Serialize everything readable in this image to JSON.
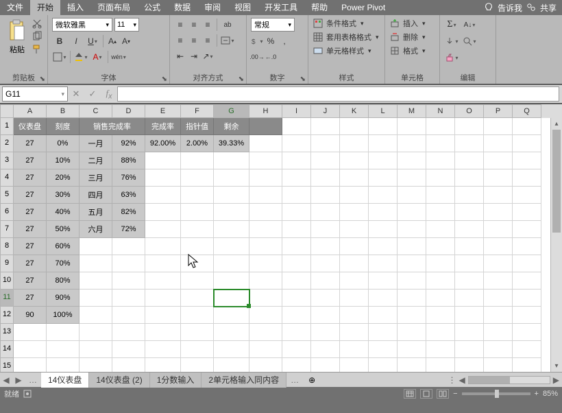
{
  "tabs": {
    "file": "文件",
    "home": "开始",
    "insert": "插入",
    "layout": "页面布局",
    "formula": "公式",
    "data": "数据",
    "review": "审阅",
    "view": "视图",
    "dev": "开发工具",
    "help": "帮助",
    "pivot": "Power Pivot",
    "tell": "告诉我",
    "share": "共享"
  },
  "ribbon": {
    "paste": "粘贴",
    "clipboard": "剪贴板",
    "font_name": "微软雅黑",
    "font_size": "11",
    "font_group": "字体",
    "align_group": "对齐方式",
    "wrap_char": "ab",
    "num_format": "常规",
    "num_group": "数字",
    "cond": "条件格式",
    "table_fmt": "套用表格格式",
    "cell_fmt": "单元格样式",
    "style_group": "样式",
    "insert_btn": "插入",
    "delete_btn": "删除",
    "format_btn": "格式",
    "cell_group": "单元格",
    "edit_group": "编辑"
  },
  "namebox": "G11",
  "columns": [
    "A",
    "B",
    "C",
    "D",
    "E",
    "F",
    "G",
    "H",
    "I",
    "J",
    "K",
    "L",
    "M",
    "N",
    "O",
    "P",
    "Q"
  ],
  "headers": {
    "a": "仪表盘",
    "b": "刻度",
    "cd": "销售完成率",
    "e": "完成率",
    "f": "指针值",
    "g": "剩余"
  },
  "rows": [
    {
      "a": "27",
      "b": "0%",
      "c": "一月",
      "d": "92%",
      "e": "92.00%",
      "f": "2.00%",
      "g": "39.33%"
    },
    {
      "a": "27",
      "b": "10%",
      "c": "二月",
      "d": "88%"
    },
    {
      "a": "27",
      "b": "20%",
      "c": "三月",
      "d": "76%"
    },
    {
      "a": "27",
      "b": "30%",
      "c": "四月",
      "d": "63%"
    },
    {
      "a": "27",
      "b": "40%",
      "c": "五月",
      "d": "82%"
    },
    {
      "a": "27",
      "b": "50%",
      "c": "六月",
      "d": "72%"
    },
    {
      "a": "27",
      "b": "60%"
    },
    {
      "a": "27",
      "b": "70%"
    },
    {
      "a": "27",
      "b": "80%"
    },
    {
      "a": "27",
      "b": "90%"
    },
    {
      "a": "90",
      "b": "100%"
    }
  ],
  "sheets": {
    "s1": "14仪表盘",
    "s2": "14仪表盘 (2)",
    "s3": "1分数输入",
    "s4": "2单元格输入同内容"
  },
  "status": {
    "ready": "就绪",
    "zoom": "85%"
  }
}
